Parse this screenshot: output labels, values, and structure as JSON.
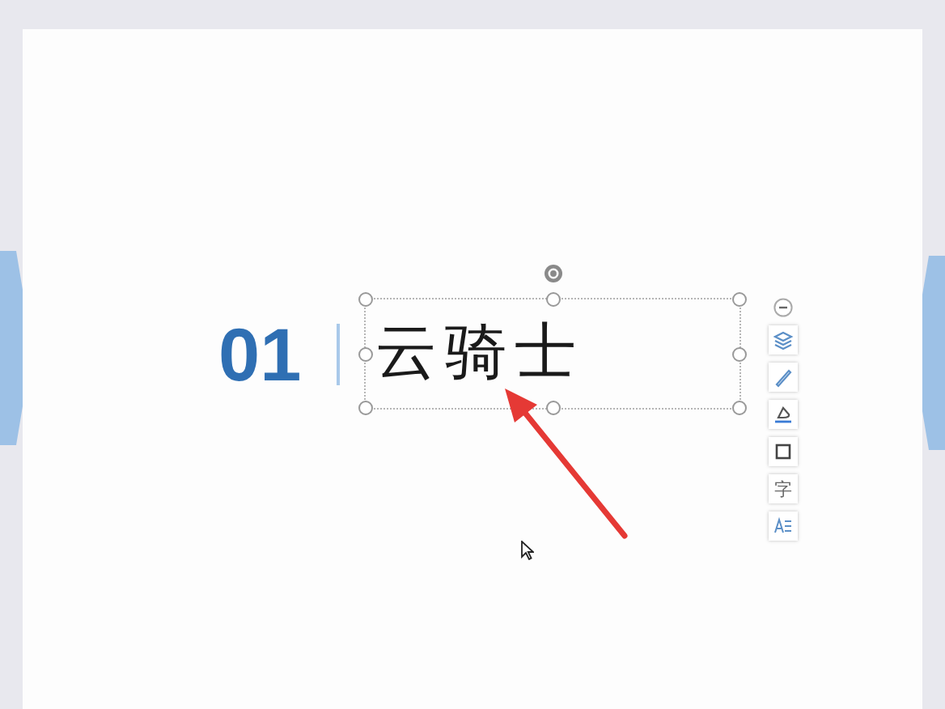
{
  "slide": {
    "number": "01",
    "title": "云骑士",
    "title_selected": true
  },
  "float_toolbar": [
    {
      "kind": "collapse"
    },
    {
      "kind": "layers"
    },
    {
      "kind": "pen"
    },
    {
      "kind": "fill"
    },
    {
      "kind": "outline"
    },
    {
      "kind": "glyph",
      "glyph": "字"
    },
    {
      "kind": "wordart"
    }
  ]
}
